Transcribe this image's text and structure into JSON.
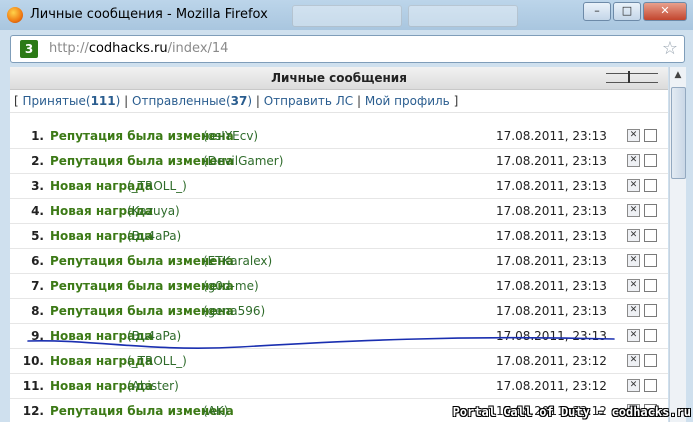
{
  "window": {
    "title": "Личные сообщения - Mozilla Firefox"
  },
  "urlbar": {
    "prefix": "http://",
    "host": "codhacks.ru",
    "path": "/index/14"
  },
  "site_icon_label": "3",
  "header": {
    "title": "Личные сообщения"
  },
  "nav": {
    "open_bracket": "[",
    "inbox_label": "Принятые",
    "inbox_count": "111",
    "sent_label": "Отправленные",
    "sent_count": "37",
    "send_label": "Отправить ЛС",
    "profile_label": "Мой профиль",
    "close_bracket": "]",
    "separator": "|"
  },
  "messages": [
    {
      "num": "1.",
      "subject": "Репутация была изменена",
      "author": "(osIYEcv)",
      "date": "17.08.2011, 23:13"
    },
    {
      "num": "2.",
      "subject": "Репутация была изменена",
      "author": "(DevilGamer)",
      "date": "17.08.2011, 23:13"
    },
    {
      "num": "3.",
      "subject": "Новая награда",
      "author": "(_TROLL_)",
      "date": "17.08.2011, 23:13"
    },
    {
      "num": "4.",
      "subject": "Новая награда",
      "author": "(Kazuya)",
      "date": "17.08.2011, 23:13"
    },
    {
      "num": "5.",
      "subject": "Новая награда",
      "author": "(Bu4aPa)",
      "date": "17.08.2011, 23:13"
    },
    {
      "num": "6.",
      "subject": "Репутация была изменена",
      "author": "(ETKaralex)",
      "date": "17.08.2011, 23:13"
    },
    {
      "num": "7.",
      "subject": "Репутация была изменена",
      "author": "(g0d-me)",
      "date": "17.08.2011, 23:13"
    },
    {
      "num": "8.",
      "subject": "Репутация была изменена",
      "author": "(gena596)",
      "date": "17.08.2011, 23:13"
    },
    {
      "num": "9.",
      "subject": "Новая награда",
      "author": "(Bu4aPa)",
      "date": "17.08.2011, 23:13"
    },
    {
      "num": "10.",
      "subject": "Новая награда",
      "author": "(_TROLL_)",
      "date": "17.08.2011, 23:12"
    },
    {
      "num": "11.",
      "subject": "Новая награда",
      "author": "(Abister)",
      "date": "17.08.2011, 23:12"
    },
    {
      "num": "12.",
      "subject": "Репутация была изменена",
      "author": "(AK)",
      "date": "17.08.2011, 23:12"
    }
  ],
  "watermark": "Portal Call of Duty - codhacks.ru",
  "colors": {
    "subject": "#3c7a16",
    "link": "#2a5d8f",
    "annotation": "#1a2fb0"
  },
  "icons": {
    "browser": "firefox-logo-icon",
    "bookmark": "star-icon",
    "delete": "delete-icon"
  }
}
